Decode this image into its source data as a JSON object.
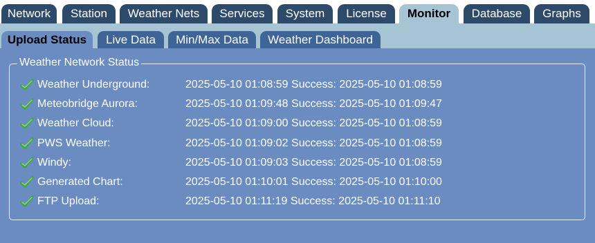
{
  "main_tabs": [
    "Network",
    "Station",
    "Weather Nets",
    "Services",
    "System",
    "License",
    "Monitor",
    "Database",
    "Graphs"
  ],
  "active_main_tab": "Monitor",
  "sub_tabs": [
    "Upload Status",
    "Live Data",
    "Min/Max Data",
    "Weather Dashboard"
  ],
  "active_sub_tab": "Upload Status",
  "panel": {
    "legend": "Weather Network Status",
    "rows": [
      {
        "label": "Weather Underground:",
        "value": "2025-05-10 01:08:59 Success: 2025-05-10 01:08:59"
      },
      {
        "label": "Meteobridge Aurora:",
        "value": "2025-05-10 01:09:48 Success: 2025-05-10 01:09:47"
      },
      {
        "label": "Weather Cloud:",
        "value": "2025-05-10 01:09:00 Success: 2025-05-10 01:08:59"
      },
      {
        "label": "PWS Weather:",
        "value": "2025-05-10 01:09:02 Success: 2025-05-10 01:08:59"
      },
      {
        "label": "Windy:",
        "value": "2025-05-10 01:09:03 Success: 2025-05-10 01:08:59"
      },
      {
        "label": "Generated Chart:",
        "value": "2025-05-10 01:10:01 Success: 2025-05-10 01:10:00"
      },
      {
        "label": "FTP Upload:",
        "value": "2025-05-10 01:11:19 Success: 2025-05-10 01:11:10"
      }
    ],
    "status_icon": "check-icon"
  },
  "colors": {
    "background": "#6a8cc1",
    "tab": "#2e4a6b",
    "active_tab": "#a7c4d4",
    "subtab": "#3f6497",
    "check": "#3fa83a"
  }
}
